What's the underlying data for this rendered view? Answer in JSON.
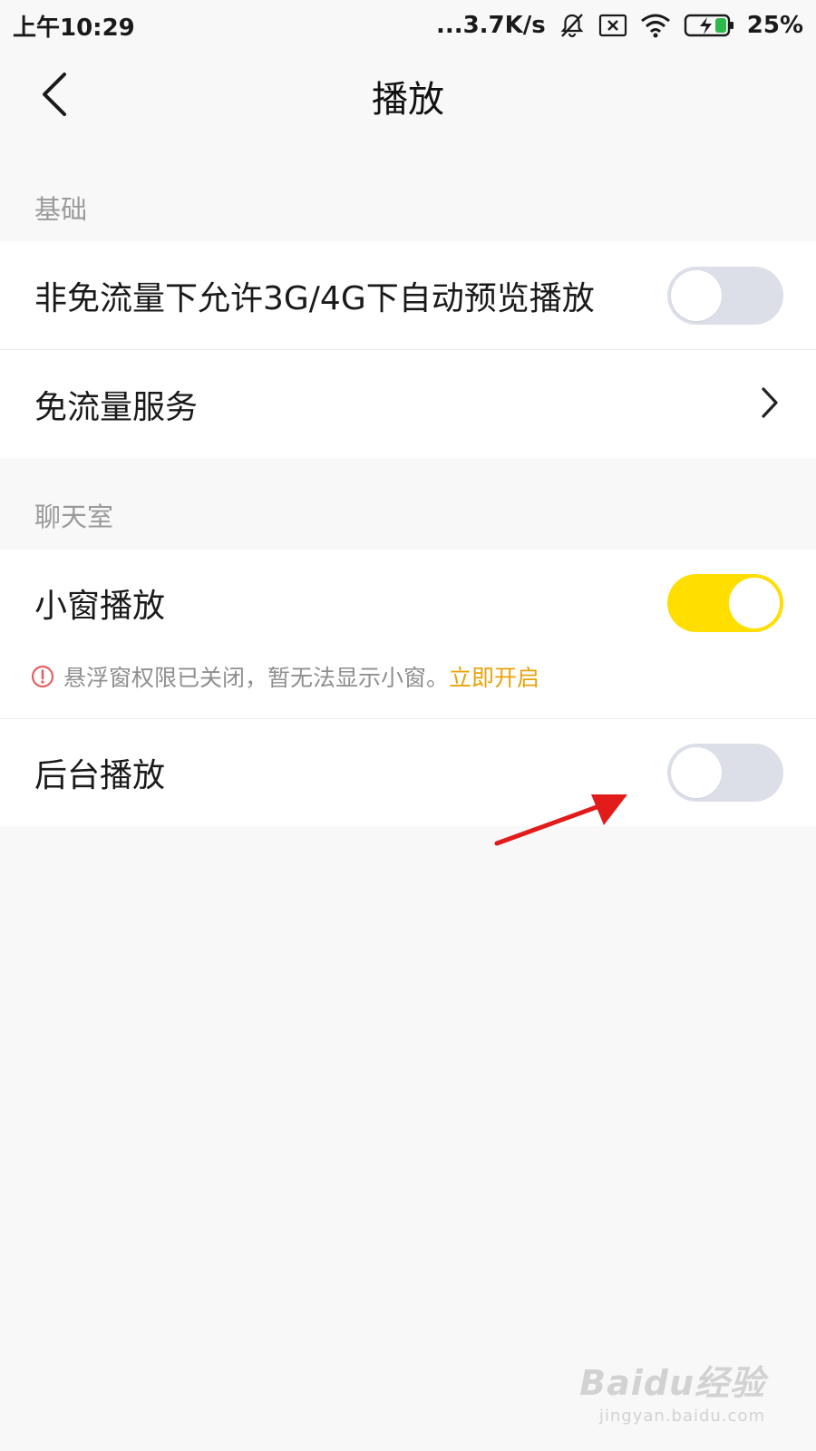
{
  "status_bar": {
    "time": "上午10:29",
    "network_speed": "...3.7K/s",
    "battery": "25%",
    "icons": [
      "bell-muted-icon",
      "sim-off-icon",
      "wifi-icon",
      "battery-charging-icon"
    ]
  },
  "header": {
    "title": "播放",
    "back_icon": "chevron-left-icon"
  },
  "sections": [
    {
      "label": "基础",
      "rows": [
        {
          "label": "非免流量下允许3G/4G下自动预览播放",
          "control": "toggle",
          "checked": false
        },
        {
          "label": "免流量服务",
          "control": "chevron-right-icon"
        }
      ]
    },
    {
      "label": "聊天室",
      "rows": [
        {
          "label": "小窗播放",
          "control": "toggle",
          "checked": true,
          "warning": {
            "text": "悬浮窗权限已关闭，暂无法显示小窗。",
            "link": "立即开启",
            "icon": "alert-circle-icon"
          }
        },
        {
          "label": "后台播放",
          "control": "toggle",
          "checked": false
        }
      ]
    }
  ],
  "colors": {
    "toggle_on": "#ffde00",
    "toggle_off": "#dcdfe8",
    "warning_link": "#e9a30c",
    "warning_icon": "#e66060",
    "annotation_arrow": "#e21b1b"
  },
  "watermark": {
    "logo": "Baidu经验",
    "url": "jingyan.baidu.com"
  }
}
